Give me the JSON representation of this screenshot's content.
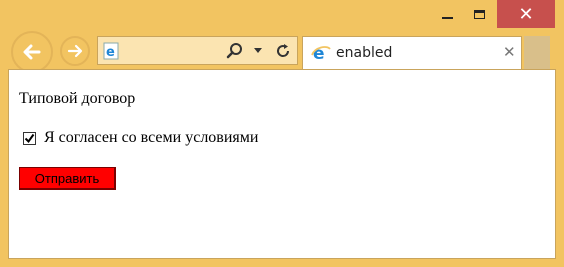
{
  "window": {
    "caption": {
      "minimize_icon": "minimize-icon",
      "maximize_icon": "maximize-icon",
      "close_glyph": "✕"
    }
  },
  "nav": {
    "back_icon": "arrow-left-icon",
    "forward_icon": "arrow-right-icon"
  },
  "address": {
    "site_icon": "ie-logo-icon",
    "search_icon": "search-icon",
    "dropdown_icon": "chevron-down-icon",
    "refresh_icon": "refresh-icon"
  },
  "tab": {
    "title": "enabled",
    "close_glyph": "✕"
  },
  "page": {
    "heading": "Типовой договор",
    "agree_label": "Я согласен со всеми условиями",
    "agree_checked": true,
    "submit_label": "Отправить"
  },
  "colors": {
    "frame": "#f2c461",
    "close_button": "#c7504d",
    "submit_button": "#ff0000"
  }
}
